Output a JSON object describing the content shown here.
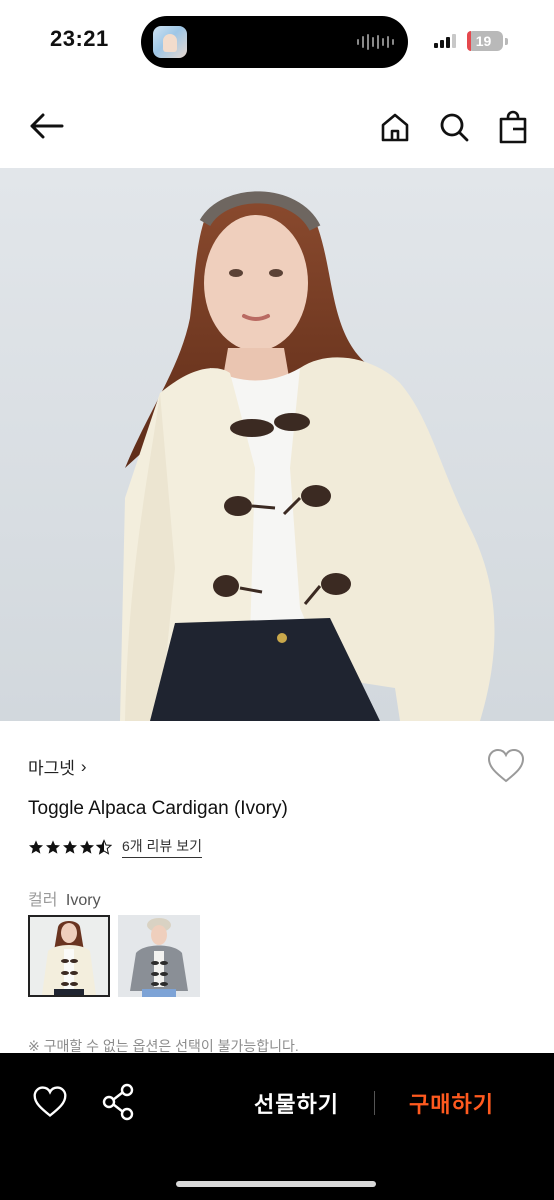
{
  "status_bar": {
    "time": "23:21",
    "battery": "19"
  },
  "nav": {
    "back_icon": "arrow-left-icon",
    "home_icon": "home-icon",
    "search_icon": "search-icon",
    "cart_icon": "shopping-bag-icon"
  },
  "product": {
    "brand": "마그넷",
    "brand_chevron": "›",
    "title": "Toggle Alpaca Cardigan (Ivory)",
    "rating": 4.5,
    "review_link": "6개 리뷰 보기",
    "color_label": "컬러",
    "color_value": "Ivory",
    "notice": "※ 구매할 수 없는 옵션은 선택이 불가능합니다."
  },
  "bottom_bar": {
    "gift_label": "선물하기",
    "buy_label": "구매하기"
  },
  "colors": {
    "accent": "#ff5a1f",
    "bottom_bar_bg": "#000000"
  }
}
